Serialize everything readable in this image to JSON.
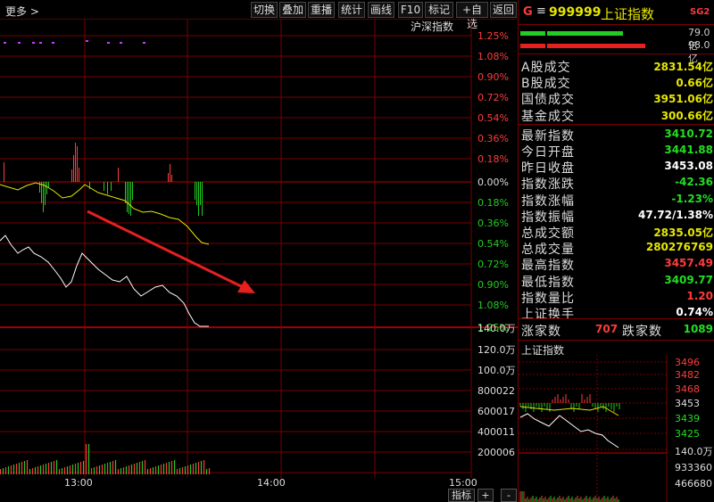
{
  "toolbar": {
    "more_label": "更多 >",
    "buttons": [
      "切换",
      "叠加",
      "重播",
      "统计",
      "画线",
      "F10",
      "+自选",
      "返回"
    ]
  },
  "chart": {
    "index_label": "沪深指数",
    "pct_labels_top": [
      "1.25%",
      "1.08%",
      "0.90%",
      "0.72%",
      "0.54%",
      "0.36%",
      "0.18%",
      "0.00%"
    ],
    "pct_labels_bottom": [
      "0.18%",
      "0.36%",
      "0.54%",
      "0.72%",
      "0.90%",
      "1.08%",
      "1.25%"
    ],
    "vol_labels": [
      "140.0万",
      "120.0万",
      "100.0万",
      "800022",
      "600017",
      "400011",
      "200006"
    ],
    "time_labels": [
      "13:00",
      "14:00",
      "15:00"
    ],
    "colors": {
      "up": "#ff3b3b",
      "down": "#22cc22",
      "index_line": "#ffffff",
      "avg_line": "#e6e600",
      "grid": "#7a0000",
      "arrow": "#e62020"
    }
  },
  "bottom_bar": {
    "tab_label": "指标",
    "plus": "+",
    "minus": "-"
  },
  "panel": {
    "prefix": "G",
    "menu_icon": "≡",
    "code": "999999",
    "name": "上证指数",
    "badge": "SG2",
    "bar_values": [
      "79.0亿",
      "98.0亿"
    ],
    "rows": [
      {
        "label": "A股成交",
        "value": "2831.54亿",
        "color": "#e6e600"
      },
      {
        "label": "B股成交",
        "value": "0.66亿",
        "color": "#e6e600"
      },
      {
        "label": "国债成交",
        "value": "3951.06亿",
        "color": "#e6e600"
      },
      {
        "label": "基金成交",
        "value": "300.66亿",
        "color": "#e6e600"
      },
      {
        "label": "最新指数",
        "value": "3410.72",
        "color": "#22dd22"
      },
      {
        "label": "今日开盘",
        "value": "3441.88",
        "color": "#22dd22"
      },
      {
        "label": "昨日收盘",
        "value": "3453.08",
        "color": "#ffffff"
      },
      {
        "label": "指数涨跌",
        "value": "-42.36",
        "color": "#22dd22"
      },
      {
        "label": "指数涨幅",
        "value": "-1.23%",
        "color": "#22dd22"
      },
      {
        "label": "指数振幅",
        "value": "47.72/1.38%",
        "color": "#ffffff"
      },
      {
        "label": "总成交额",
        "value": "2835.05亿",
        "color": "#e6e600"
      },
      {
        "label": "总成交量",
        "value": "280276769",
        "color": "#e6e600"
      },
      {
        "label": "最高指数",
        "value": "3457.49",
        "color": "#ff3b3b"
      },
      {
        "label": "最低指数",
        "value": "3409.77",
        "color": "#22dd22"
      },
      {
        "label": "指数量比",
        "value": "1.20",
        "color": "#ff3b3b"
      },
      {
        "label": "上证换手",
        "value": "0.74%",
        "color": "#ffffff"
      }
    ],
    "up_count_label": "涨家数",
    "up_count": "707",
    "down_count_label": "跌家数",
    "down_count": "1089",
    "mini_title": "上证指数",
    "mini_price_labels": [
      "3496",
      "3482",
      "3468",
      "3453",
      "3439",
      "3425"
    ],
    "mini_vol_labels": [
      "140.0万",
      "933360",
      "466680"
    ]
  }
}
